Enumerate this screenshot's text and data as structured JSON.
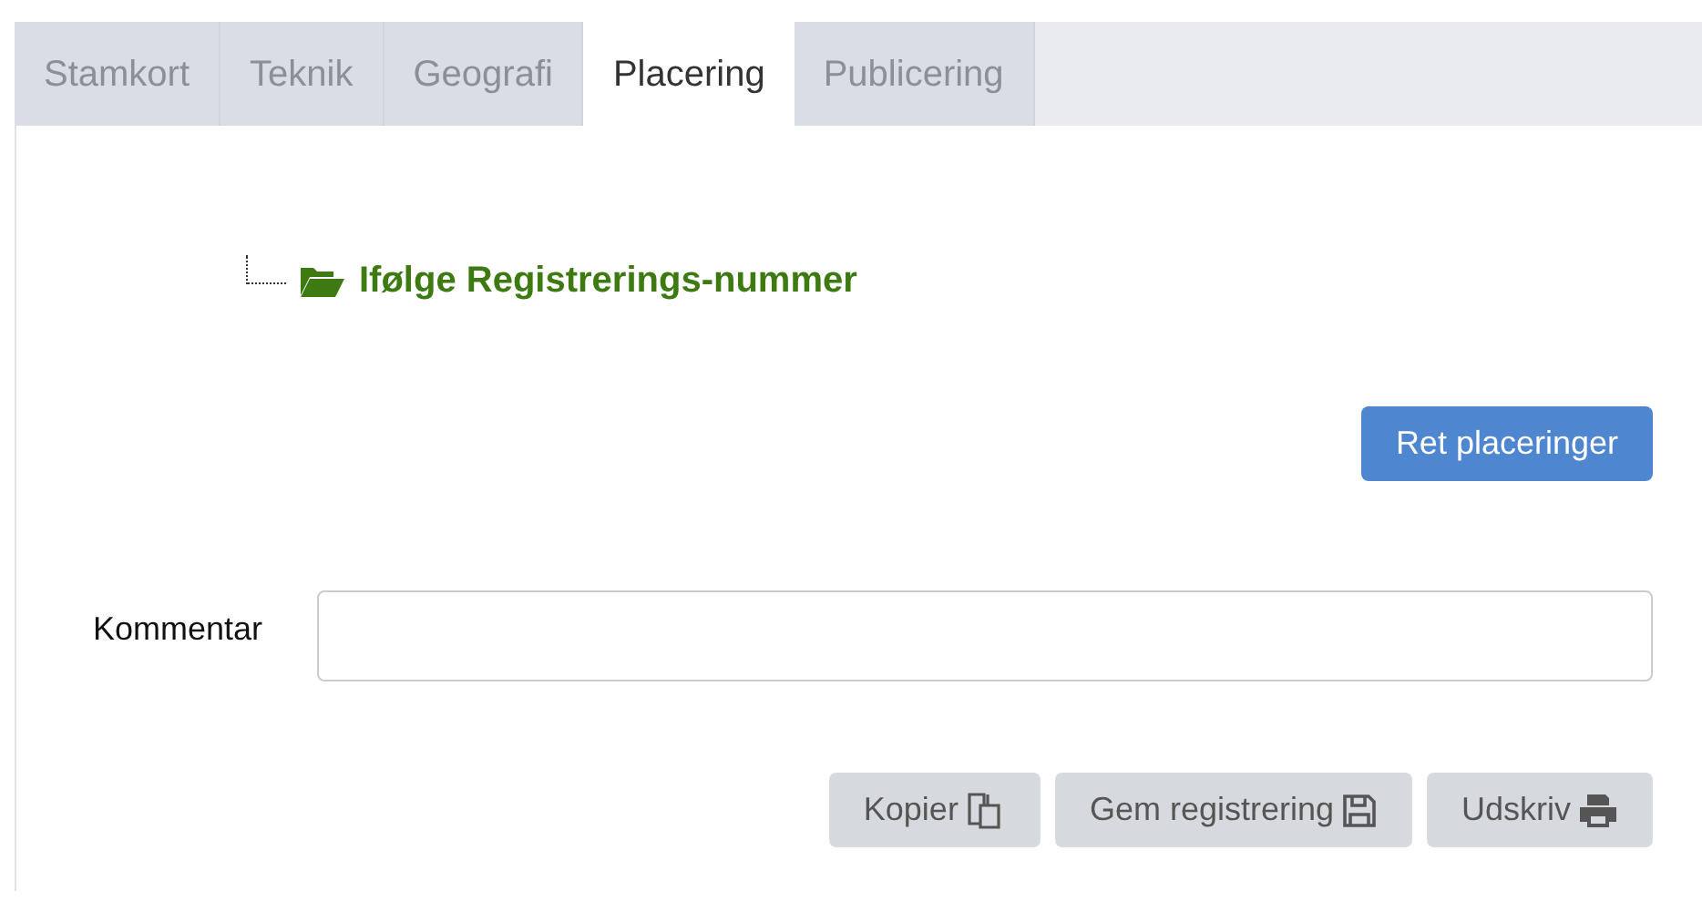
{
  "tabs": [
    {
      "label": "Stamkort",
      "selected": false
    },
    {
      "label": "Teknik",
      "selected": false
    },
    {
      "label": "Geografi",
      "selected": false
    },
    {
      "label": "Placering",
      "selected": true
    },
    {
      "label": "Publicering",
      "selected": false
    }
  ],
  "tree": {
    "label": "Ifølge Registrerings-nummer",
    "expanded": true
  },
  "edit_button": "Ret placeringer",
  "comment": {
    "label": "Kommentar"
  },
  "actions": [
    {
      "label": "Kopier",
      "kind": "copy"
    },
    {
      "label": "Gem registrering",
      "kind": "save"
    },
    {
      "label": "Udskriv",
      "kind": "print"
    }
  ]
}
